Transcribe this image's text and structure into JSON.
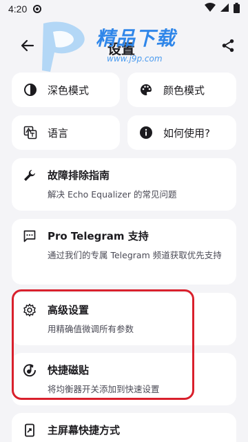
{
  "status": {
    "time": "4:20"
  },
  "header": {
    "title": "设置"
  },
  "watermark": {
    "brand": "精品下载",
    "url": "www.j9p.com"
  },
  "tiles": [
    {
      "label": "深色模式",
      "icon": "contrast-icon"
    },
    {
      "label": "颜色模式",
      "icon": "palette-icon"
    },
    {
      "label": "语言",
      "icon": "translate-icon"
    },
    {
      "label": "如何使用?",
      "icon": "info-icon"
    }
  ],
  "rows": [
    {
      "title": "故障排除指南",
      "subtitle": "解决 Echo Equalizer 的常见问题",
      "icon": "wrench-icon"
    },
    {
      "title": "Pro Telegram 支持",
      "subtitle": "通过我们的专属 Telegram 频道获取优先支持",
      "icon": "chat-dots-icon"
    },
    {
      "title": "高级设置",
      "subtitle": "用精确值微调所有参数",
      "icon": "gear-icon"
    },
    {
      "title": "快捷磁贴",
      "subtitle": "将均衡器开关添加到快速设置",
      "icon": "music-tile-icon"
    },
    {
      "title": "主屏幕快捷方式",
      "subtitle": "",
      "icon": "shortcut-icon"
    }
  ],
  "colors": {
    "background": "#F4F4F7",
    "card": "#FFFFFF",
    "highlight": "#D9202C",
    "watermark": "#2F86E9"
  }
}
